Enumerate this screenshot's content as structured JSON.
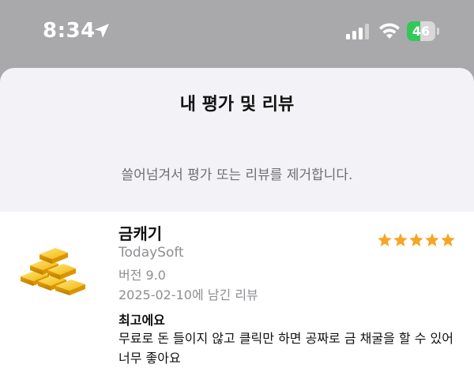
{
  "status_bar": {
    "time": "8:34",
    "battery_level": "46",
    "battery_fraction": 0.46
  },
  "sheet": {
    "title": "내 평가 및 리뷰",
    "hint": "쓸어넘겨서 평가 또는 리뷰를 제거합니다."
  },
  "review": {
    "app_name": "금캐기",
    "developer": "TodaySoft",
    "version": "버전 9.0",
    "date": "2025-02-10에 남긴 리뷰",
    "rating": 5,
    "rating_max": 5,
    "title": "최고에요",
    "body": "무료로 돈 들이지 않고 클릭만 하면 공짜로 금 채굴을 할 수 있어 너무 좋아요"
  },
  "icons": {
    "location": "location-arrow-icon",
    "signal": "cellular-signal-icon",
    "wifi": "wifi-icon",
    "charging": "bolt-icon",
    "app": "gold-bars-icon",
    "star": "star-icon"
  },
  "colors": {
    "star": "#f5a623",
    "battery": "#34c759",
    "secondary_text": "#8e8e93"
  }
}
